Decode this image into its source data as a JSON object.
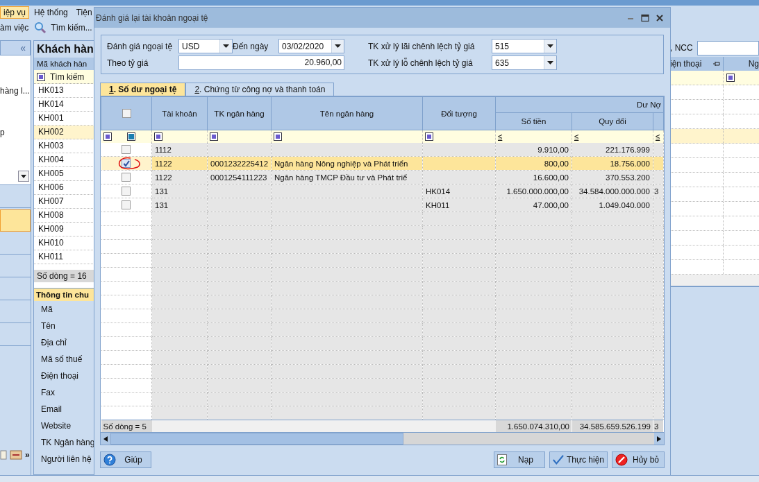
{
  "app": {
    "menu": [
      {
        "label": "iệp vụ",
        "selected": true
      },
      {
        "label": "Hệ thống",
        "selected": false
      },
      {
        "label": "Tiện",
        "selected": false
      }
    ],
    "toolbar": [
      {
        "kind": "text",
        "label": "àm việc"
      },
      {
        "kind": "search",
        "label": "Tìm kiếm..."
      }
    ],
    "left_panel": {
      "collapse": "«",
      "texts": [
        "hàng l...",
        "p"
      ],
      "nav_items": [
        {
          "selected": false
        },
        {
          "selected": true
        },
        {
          "selected": false
        },
        {
          "selected": false
        },
        {
          "selected": false
        },
        {
          "selected": false
        },
        {
          "selected": false
        }
      ],
      "more": "»"
    },
    "customer_list": {
      "title": "Khách hàn",
      "column": "Mã khách hàn",
      "search": "Tìm kiếm",
      "footer": "Số dòng = 16",
      "rows": [
        {
          "code": "HK013",
          "selected": false
        },
        {
          "code": "HK014",
          "selected": false
        },
        {
          "code": "KH001",
          "selected": false
        },
        {
          "code": "KH002",
          "selected": true
        },
        {
          "code": "KH003",
          "selected": false
        },
        {
          "code": "KH004",
          "selected": false
        },
        {
          "code": "KH005",
          "selected": false
        },
        {
          "code": "KH006",
          "selected": false
        },
        {
          "code": "KH007",
          "selected": false
        },
        {
          "code": "KH008",
          "selected": false
        },
        {
          "code": "KH009",
          "selected": false
        },
        {
          "code": "KH010",
          "selected": false
        },
        {
          "code": "KH011",
          "selected": false
        }
      ]
    },
    "info_panel": {
      "title": "Thông tin chu",
      "fields": [
        "Mã",
        "Tên",
        "Địa chỉ",
        "Mã số thuế",
        "Điện thoại",
        "Fax",
        "Email",
        "Website",
        "TK Ngân hàng",
        "Người liên hệ"
      ]
    },
    "right_grid": {
      "filter_label": ", NCC",
      "columns": [
        "iện thoại",
        "Ng"
      ]
    }
  },
  "dialog": {
    "title": "Đánh giá lại tài khoản ngoại tệ",
    "form": {
      "currency_label": "Đánh giá ngoại tệ",
      "currency": "USD",
      "date_label": "Đến ngày",
      "date": "03/02/2020",
      "rate_label": "Theo tỷ giá",
      "rate": "20.960,00",
      "gain_label": "TK xử lý lãi chênh lệch tỷ giá",
      "gain_account": "515",
      "loss_label": "TK xử lý lỗ chênh lệch tỷ giá",
      "loss_account": "635"
    },
    "tabs": [
      {
        "key": "1",
        "label": ". Số dư ngoại tệ",
        "selected": true
      },
      {
        "key": "2",
        "label": ". Chứng từ công nợ và thanh toán",
        "selected": false
      }
    ],
    "grid": {
      "select_all_checked": false,
      "columns": [
        "Tài khoản",
        "TK ngân hàng",
        "Tên ngân hàng",
        "Đối tượng"
      ],
      "group": "Dư Nợ",
      "subcolumns": [
        "Số tiền",
        "Quy đổi"
      ],
      "filter_ops": [
        "≤",
        "≤",
        "≤"
      ],
      "rows": [
        {
          "checked": false,
          "selected": false,
          "circled": false,
          "account": "1112",
          "bank_account": "",
          "bank_name": "",
          "object": "",
          "amount": "9.910,00",
          "converted": "221.176.999",
          "column_7": ""
        },
        {
          "checked": true,
          "selected": true,
          "circled": true,
          "account": "1122",
          "bank_account": "0001232225412",
          "bank_name": "Ngân hàng Nông nghiệp và Phát triển",
          "object": "",
          "amount": "800,00",
          "converted": "18.756.000",
          "column_7": ""
        },
        {
          "checked": false,
          "selected": false,
          "circled": false,
          "account": "1122",
          "bank_account": "0001254111223",
          "bank_name": "Ngân hàng TMCP Đầu tư và Phát triể",
          "object": "",
          "amount": "16.600,00",
          "converted": "370.553.200",
          "column_7": ""
        },
        {
          "checked": false,
          "selected": false,
          "circled": false,
          "account": "131",
          "bank_account": "",
          "bank_name": "",
          "object": "HK014",
          "amount": "1.650.000.000,00",
          "converted": "34.584.000.000.000",
          "column_7": "3"
        },
        {
          "checked": false,
          "selected": false,
          "circled": false,
          "account": "131",
          "bank_account": "",
          "bank_name": "",
          "object": "KH011",
          "amount": "47.000,00",
          "converted": "1.049.040.000",
          "column_7": ""
        }
      ],
      "row_count": "Số dòng = 5",
      "totals": [
        "1.650.074.310,00",
        "34.585.659.526.199",
        "3"
      ]
    },
    "buttons": [
      {
        "kind": "help",
        "label": "Giúp"
      },
      {
        "kind": "reload",
        "label": "Nạp"
      },
      {
        "kind": "run",
        "label": "Thực hiện"
      },
      {
        "kind": "cancel",
        "label": "Hủy bỏ"
      }
    ]
  }
}
